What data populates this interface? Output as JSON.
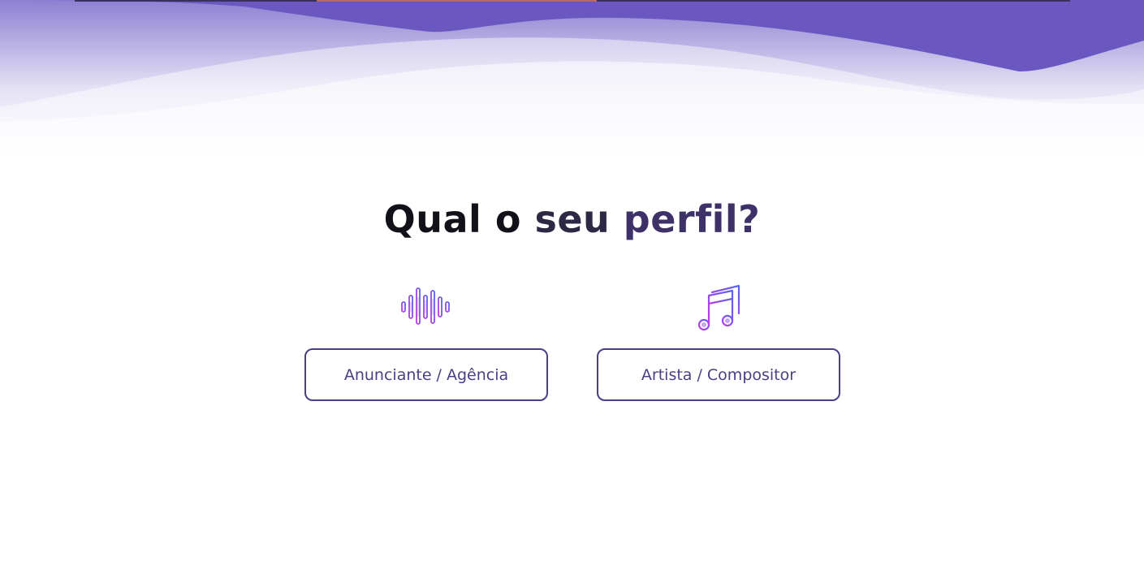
{
  "page": {
    "title_part1": "Qual o ",
    "title_part2": "seu ",
    "title_part3": "perfil?"
  },
  "profiles": [
    {
      "label": "Anunciante / Agência",
      "icon": "sound-wave-icon"
    },
    {
      "label": "Artista / Compositor",
      "icon": "music-notes-icon"
    }
  ],
  "colors": {
    "brand_purple": "#6a58c0",
    "button_border": "#4b3f84",
    "title_dark": "#121018",
    "icon_gradient_start": "#c13be0",
    "icon_gradient_end": "#5863f0"
  }
}
